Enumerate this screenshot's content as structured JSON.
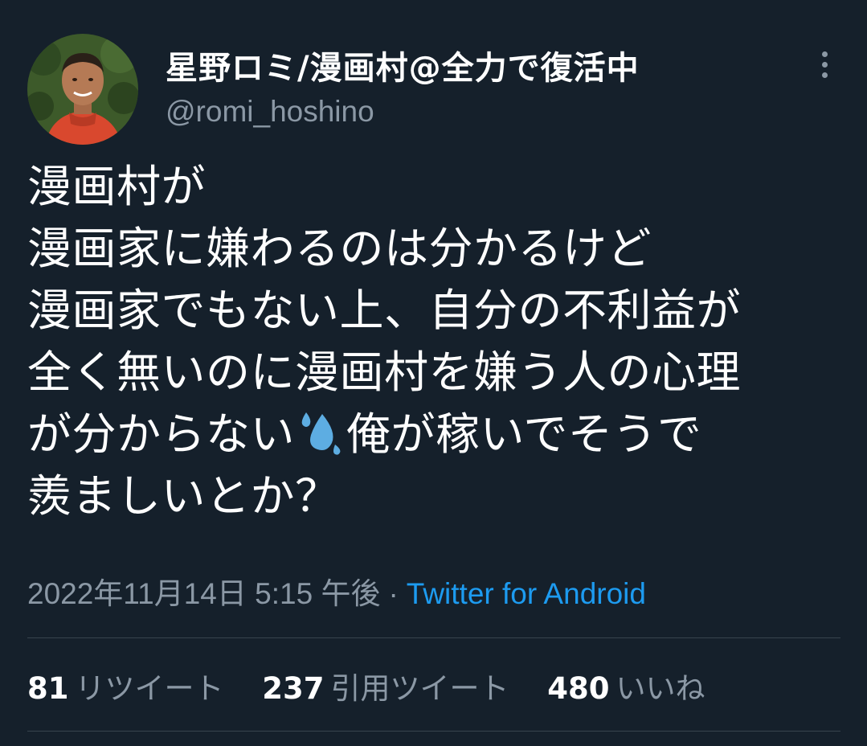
{
  "user": {
    "display_name": "星野ロミ/漫画村@全力で復活中",
    "handle": "@romi_hoshino",
    "avatar": "profile-photo"
  },
  "tweet": {
    "lines": [
      "漫画村が",
      "漫画家に嫌わるのは分かるけど",
      "漫画家でもない上、自分の不利益が",
      "全く無いのに漫画村を嫌う人の心理",
      "が分からない",
      "俺が稼いでそうで",
      "羨ましいとか？"
    ],
    "emoji": "sweat-droplets-icon"
  },
  "meta": {
    "datetime": "2022年11月14日 5:15 午後",
    "separator": "·",
    "source": "Twitter for Android"
  },
  "stats": {
    "retweets_count": "81",
    "retweets_label": "リツイート",
    "quotes_count": "237",
    "quotes_label": "引用ツイート",
    "likes_count": "480",
    "likes_label": "いいね"
  },
  "colors": {
    "background": "#15202b",
    "text": "#ffffff",
    "secondary": "#8b98a5",
    "link": "#1d9bf0",
    "divider": "#38444d"
  }
}
